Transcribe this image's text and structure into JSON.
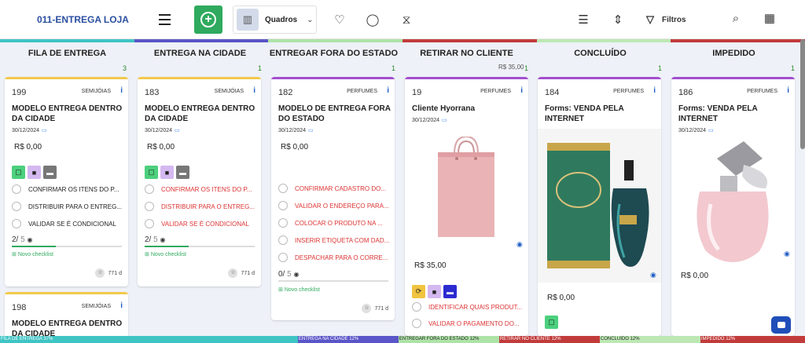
{
  "header": {
    "brand": "011-ENTREGA LOJA",
    "view_label": "Quadros",
    "filters_label": "Filtros",
    "icons": [
      "menu-icon",
      "add-circle-icon",
      "board-icon",
      "chevron-down-icon",
      "heart-icon",
      "whatsapp-icon",
      "hourglass-icon",
      "list-icon",
      "collapse-icon",
      "filter-icon",
      "search-icon",
      "calendar-settings-icon"
    ]
  },
  "columns": [
    {
      "title": "FILA DE ENTREGA",
      "count": "3",
      "amount": "",
      "color": "#3fc4c4"
    },
    {
      "title": "ENTREGA NA CIDADE",
      "count": "1",
      "amount": "",
      "color": "#5a55c8"
    },
    {
      "title": "ENTREGAR FORA DO ESTADO",
      "count": "1",
      "amount": "",
      "color": "#aee3a8"
    },
    {
      "title": "RETIRAR NO CLIENTE",
      "count": "1",
      "amount": "R$ 35,00",
      "color": "#c23b3b"
    },
    {
      "title": "CONCLUÍDO",
      "count": "1",
      "amount": "",
      "color": "#bde8b4"
    },
    {
      "title": "IMPEDIDO",
      "count": "1",
      "amount": "",
      "color": "#c23b3b"
    }
  ],
  "cards": {
    "c199": {
      "id": "199",
      "category": "SEMIJÓIAS",
      "title": "MODELO ENTREGA DENTRO DA CIDADE",
      "date": "30/12/2024",
      "value": "R$ 0,00",
      "checklist": [
        "CONFIRMAR OS ITENS DO P...",
        "DISTRIBUIR PARA O ENTREG...",
        "VALIDAR SE É CONDICIONAL"
      ],
      "progress_done": "2/",
      "progress_total": "5",
      "new_checklist": "Novo checklist",
      "days": "771 d"
    },
    "c183": {
      "id": "183",
      "category": "SEMIJÓIAS",
      "title": "MODELO ENTREGA DENTRO DA CIDADE",
      "date": "30/12/2024",
      "value": "R$ 0,00",
      "checklist": [
        "CONFIRMAR OS ITENS DO P...",
        "DISTRIBUIR PARA O ENTREG...",
        "VALIDAR SE É CONDICIONAL"
      ],
      "progress_done": "2/",
      "progress_total": "5",
      "new_checklist": "Novo checklist",
      "days": "771 d"
    },
    "c182": {
      "id": "182",
      "category": "PERFUMES",
      "title": "MODELO DE ENTREGA FORA DO ESTADO",
      "date": "30/12/2024",
      "value": "R$ 0,00",
      "checklist": [
        "CONFIRMAR CADASTRO DO...",
        "VALIDAR O ENDEREÇO PARA...",
        "COLOCAR O PRODUTO NA ...",
        "INSERIR ETIQUETA COM DAD...",
        "DESPACHAR PARA O CORRE..."
      ],
      "progress_done": "0/",
      "progress_total": "5",
      "new_checklist": "Novo checklist",
      "days": "771 d"
    },
    "c19": {
      "id": "19",
      "category": "PERFUMES",
      "title": "Cliente Hyorrana",
      "date": "30/12/2024",
      "value": "R$ 35,00",
      "checklist": [
        "IDENTIFICAR QUAIS PRODUT...",
        "VALIDAR O PAGAMENTO DO..."
      ]
    },
    "c184": {
      "id": "184",
      "category": "PERFUMES",
      "title": "Forms: VENDA PELA INTERNET",
      "value": "R$ 0,00"
    },
    "c186": {
      "id": "186",
      "category": "PERFUMES",
      "title": "Forms: VENDA PELA INTERNET",
      "date": "30/12/2024",
      "value": "R$ 0,00"
    },
    "c198": {
      "id": "198",
      "category": "SEMIJÓIAS",
      "title": "MODELO ENTREGA DENTRO DA CIDADE"
    }
  },
  "footer": [
    {
      "label": "FILA DE ENTREGA 37%",
      "color": "#3fc4c4",
      "share": 0.37
    },
    {
      "label": "ENTREGA NA CIDADE 12%",
      "color": "#5a55c8",
      "share": 0.125
    },
    {
      "label": "ENTREGAR FORA DO ESTADO 12%",
      "color": "#aee3a8",
      "share": 0.125
    },
    {
      "label": "RETIRAR NO CLIENTE 12%",
      "color": "#c23b3b",
      "share": 0.125
    },
    {
      "label": "CONCLUÍDO 12%",
      "color": "#bde8b4",
      "share": 0.125
    },
    {
      "label": "IMPEDIDO 12%",
      "color": "#c23b3b",
      "share": 0.13
    }
  ]
}
